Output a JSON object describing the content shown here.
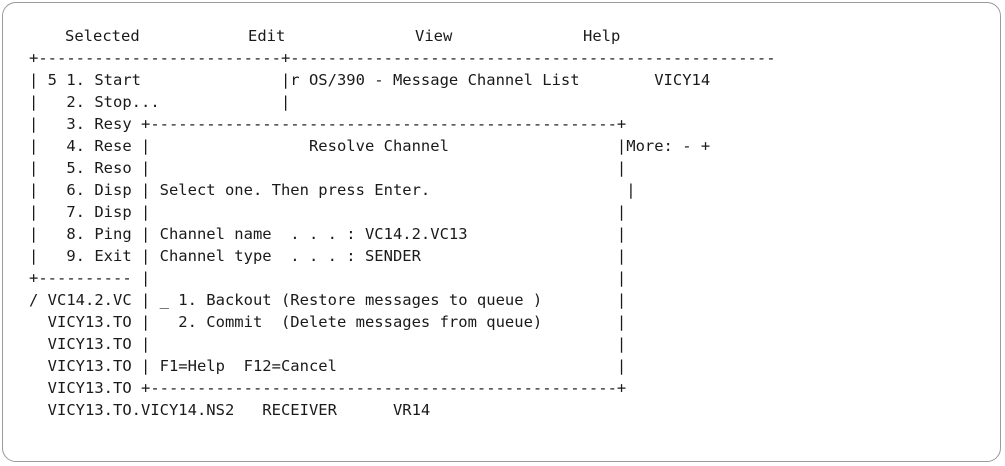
{
  "menubar": {
    "items": [
      "Selected",
      "Edit",
      "View",
      "Help"
    ]
  },
  "screen_lines": [
    "+--------------------------+----------------------------------------------------",
    "| 5 1. Start               |r OS/390 - Message Channel List        VICY14",
    "|   2. Stop...             |",
    "|   3. Resy +--------------------------------------------------+",
    "|   4. Rese |                 Resolve Channel                  |More: - +",
    "|   5. Reso |                                                  |",
    "|   6. Disp | Select one. Then press Enter.                     |",
    "|   7. Disp |                                                  |",
    "|   8. Ping | Channel name  . . . : VC14.2.VC13                |",
    "|   9. Exit | Channel type  . . . : SENDER                     |",
    "+---------- |                                                  |",
    "/ VC14.2.VC | _ 1. Backout (Restore messages to queue )        |",
    "  VICY13.TO |   2. Commit  (Delete messages from queue)        |",
    "  VICY13.TO |                                                  |",
    "  VICY13.TO | F1=Help  F12=Cancel                              |",
    "  VICY13.TO +--------------------------------------------------+",
    "  VICY13.TO.VICY14.NS2   RECEIVER      VR14"
  ],
  "dialog": {
    "selection_value": "_"
  }
}
